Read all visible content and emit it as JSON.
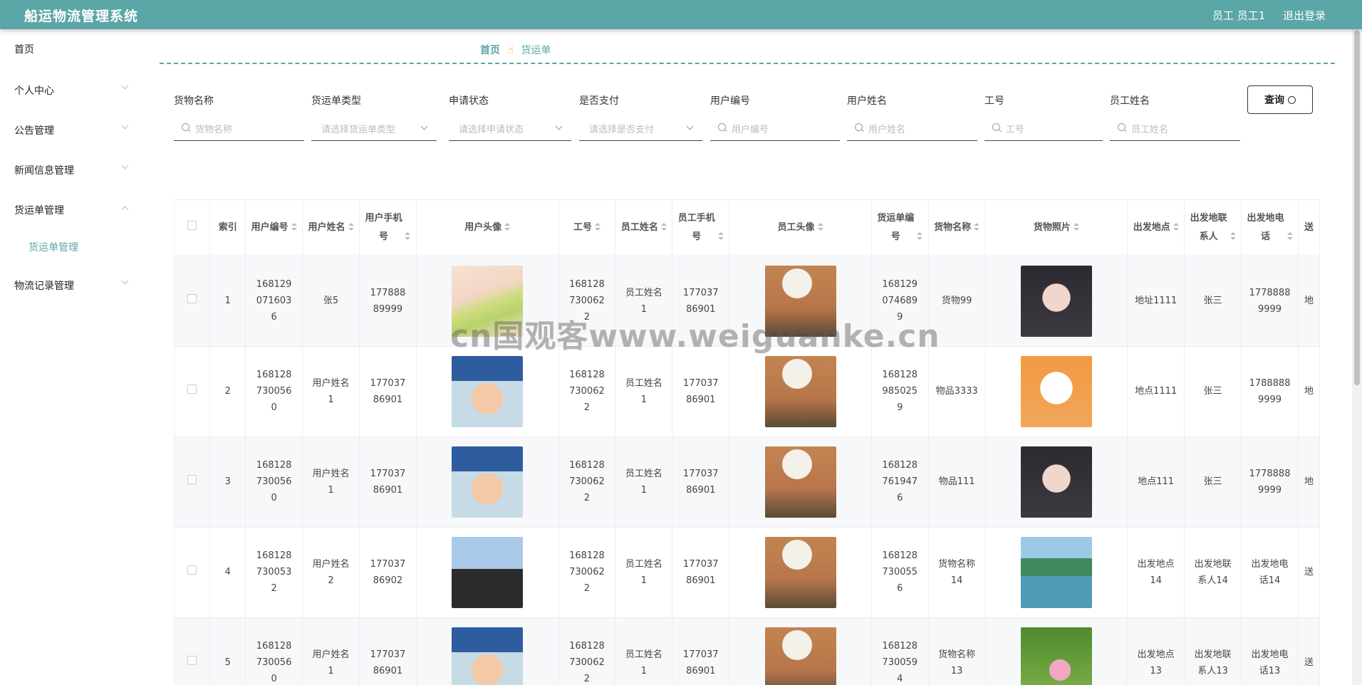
{
  "header": {
    "title": "船运物流管理系统",
    "user_role": "员工 员工1",
    "logout": "退出登录"
  },
  "sidebar": {
    "items": [
      {
        "label": "首页"
      },
      {
        "label": "个人中心"
      },
      {
        "label": "公告管理"
      },
      {
        "label": "新闻信息管理"
      },
      {
        "label": "货运单管理"
      },
      {
        "label": "物流记录管理"
      }
    ],
    "submenu": {
      "label": "货运单管理"
    }
  },
  "breadcrumb": {
    "home": "首页",
    "sep_icon": "hand-point-icon",
    "current": "货运单"
  },
  "filters": [
    {
      "label": "货物名称",
      "placeholder": "货物名称",
      "kind": "text"
    },
    {
      "label": "货运单类型",
      "placeholder": "请选择货运单类型",
      "kind": "select"
    },
    {
      "label": "申请状态",
      "placeholder": "请选择申请状态",
      "kind": "select"
    },
    {
      "label": "是否支付",
      "placeholder": "请选择是否支付",
      "kind": "select"
    },
    {
      "label": "用户编号",
      "placeholder": "用户编号",
      "kind": "text"
    },
    {
      "label": "用户姓名",
      "placeholder": "用户姓名",
      "kind": "text"
    },
    {
      "label": "工号",
      "placeholder": "工号",
      "kind": "text"
    },
    {
      "label": "员工姓名",
      "placeholder": "员工姓名",
      "kind": "text"
    }
  ],
  "query_button": "查询",
  "table": {
    "headers": [
      "索引",
      "用户编号",
      "用户姓名",
      "用户手机号",
      "用户头像",
      "工号",
      "员工姓名",
      "员工手机号",
      "员工头像",
      "货运单编号",
      "货物名称",
      "货物照片",
      "出发地点",
      "出发地联系人",
      "出发地电话",
      "送"
    ],
    "rows": [
      {
        "index": "1",
        "user_no": "1681290716036",
        "user_name": "张5",
        "user_phone": "17788889999",
        "user_avatar": "img-anime",
        "staff_no": "1681287300622",
        "staff_name": "员工姓名1",
        "staff_phone": "17703786901",
        "staff_avatar": "img-cat",
        "order_no": "1681290746899",
        "goods_name": "货物99",
        "goods_photo": "img-girl",
        "from_place": "地址1111",
        "from_contact": "张三",
        "from_phone": "17788889999",
        "to_partial": "地"
      },
      {
        "index": "2",
        "user_no": "1681287300560",
        "user_name": "用户姓名1",
        "user_phone": "17703786901",
        "user_avatar": "img-shin",
        "staff_no": "1681287300622",
        "staff_name": "员工姓名1",
        "staff_phone": "17703786901",
        "staff_avatar": "img-cat",
        "order_no": "1681289850259",
        "goods_name": "物品3333",
        "goods_photo": "img-cartoon",
        "from_place": "地点1111",
        "from_contact": "张三",
        "from_phone": "17888889999",
        "to_partial": "地"
      },
      {
        "index": "3",
        "user_no": "1681287300560",
        "user_name": "用户姓名1",
        "user_phone": "17703786901",
        "user_avatar": "img-shin",
        "staff_no": "1681287300622",
        "staff_name": "员工姓名1",
        "staff_phone": "17703786901",
        "staff_avatar": "img-cat",
        "order_no": "1681287619476",
        "goods_name": "物品111",
        "goods_photo": "img-girl",
        "from_place": "地点111",
        "from_contact": "张三",
        "from_phone": "17788889999",
        "to_partial": "地"
      },
      {
        "index": "4",
        "user_no": "1681287300532",
        "user_name": "用户姓名2",
        "user_phone": "17703786902",
        "user_avatar": "img-boy",
        "staff_no": "1681287300622",
        "staff_name": "员工姓名1",
        "staff_phone": "17703786901",
        "staff_avatar": "img-cat",
        "order_no": "1681287300556",
        "goods_name": "货物名称14",
        "goods_photo": "img-scenery",
        "from_place": "出发地点14",
        "from_contact": "出发地联系人14",
        "from_phone": "出发地电话14",
        "to_partial": "送"
      },
      {
        "index": "5",
        "user_no": "1681287300560",
        "user_name": "用户姓名1",
        "user_phone": "17703786901",
        "user_avatar": "img-shin",
        "staff_no": "1681287300622",
        "staff_name": "员工姓名1",
        "staff_phone": "17703786901",
        "staff_avatar": "img-cat",
        "order_no": "1681287300594",
        "goods_name": "货物名称13",
        "goods_photo": "img-lotus",
        "from_place": "出发地点13",
        "from_contact": "出发地联系人13",
        "from_phone": "出发地电话13",
        "to_partial": "送"
      }
    ]
  },
  "watermark": "cn国观客www.weiguanke.cn",
  "colors": {
    "accent": "#5ba6a7",
    "header_bg": "#5ba6a7"
  }
}
